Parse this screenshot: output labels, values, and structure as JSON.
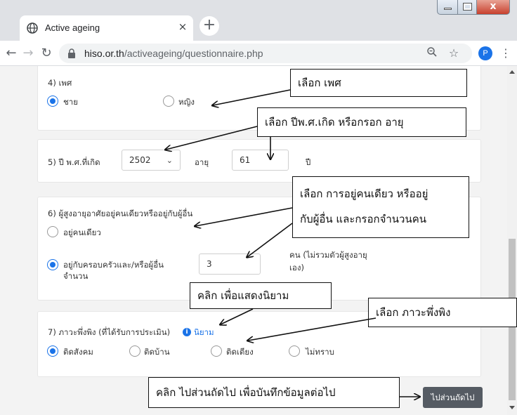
{
  "browser": {
    "tab_title": "Active ageing",
    "tab_close": "×",
    "new_tab": "+",
    "url_host": "hiso.or.th",
    "url_path": "/activeageing/questionnaire.php",
    "profile_initial": "P",
    "window_close": "x"
  },
  "q4": {
    "label": "4) เพศ",
    "options": [
      {
        "label": "ชาย",
        "checked": true
      },
      {
        "label": "หญิง",
        "checked": false
      }
    ]
  },
  "q5": {
    "label": "5) ปี พ.ศ.ที่เกิด",
    "year_value": "2502",
    "age_label": "อายุ",
    "age_value": "61",
    "age_unit": "ปี"
  },
  "q6": {
    "label": "6) ผู้สูงอายุอาศัยอยู่คนเดียวหรืออยู่กับผู้อื่น",
    "option_alone": "อยู่คนเดียว",
    "option_with_others_line1": "อยู่กับครอบครัวและ/หรือผู้อื่น",
    "option_with_others_line2": "จำนวน",
    "count_value": "3",
    "count_unit_line1": "คน (ไม่รวมตัวผู้สูงอายุ",
    "count_unit_line2": "เอง)",
    "selected": "with_others"
  },
  "q7": {
    "label": "7) ภาวะพึ่งพิง (ที่ได้รับการประเมิน)",
    "info_link": "นิยาม",
    "options": [
      {
        "label": "ติดสังคม",
        "checked": true
      },
      {
        "label": "ติดบ้าน",
        "checked": false
      },
      {
        "label": "ติดเตียง",
        "checked": false
      },
      {
        "label": "ไม่ทราบ",
        "checked": false
      }
    ]
  },
  "next_button": "ไปส่วนถัดไป",
  "annotations": {
    "gender": "เลือก เพศ",
    "birth_year": "เลือก ปีพ.ศ.เกิด หรือกรอก อายุ",
    "living_line1": "เลือก การอยู่คนเดียว หรืออยู่",
    "living_line2": "กับผู้อื่น และกรอกจำนวนคน",
    "definition": "คลิก เพื่อแสดงนิยาม",
    "dependency": "เลือก ภาวะพึ่งพิง",
    "next": "คลิก ไปส่วนถัดไป เพื่อบันทึกข้อมูลต่อไป"
  },
  "colors": {
    "accent": "#1a73e8",
    "button": "#555b63"
  }
}
